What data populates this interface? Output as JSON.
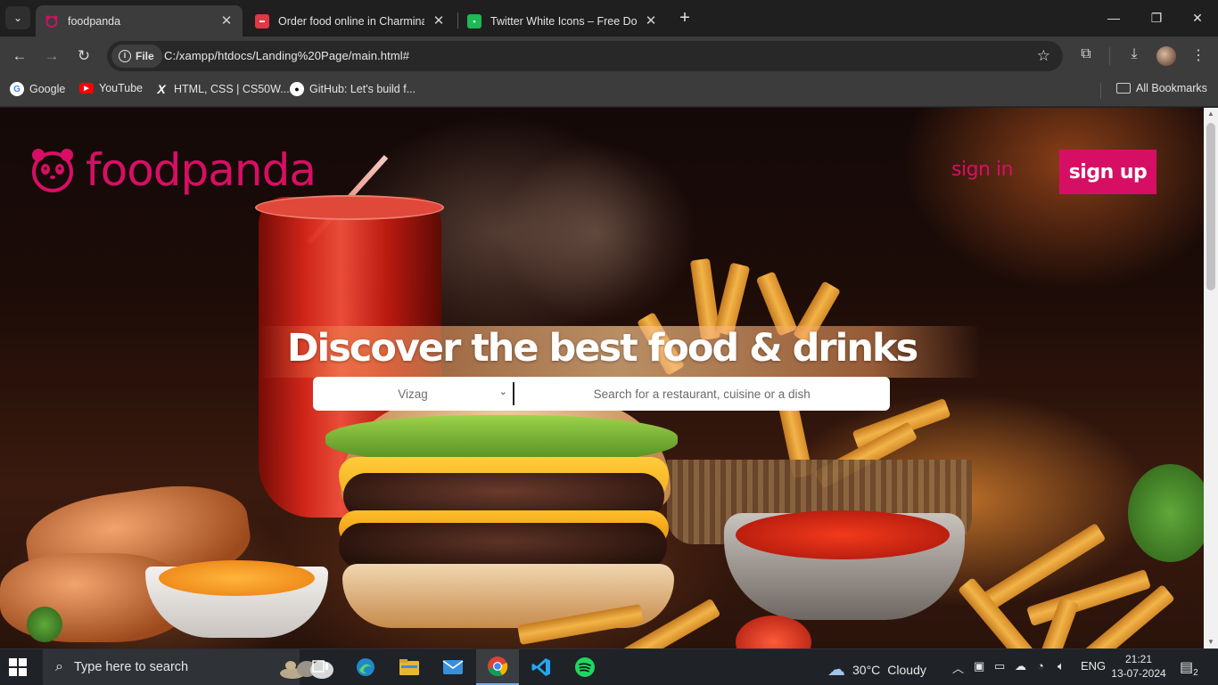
{
  "browser": {
    "tabs": [
      {
        "title": "foodpanda",
        "active": true
      },
      {
        "title": "Order food online in Charminar",
        "active": false
      },
      {
        "title": "Twitter White Icons – Free Down",
        "active": false
      }
    ],
    "site_chip": "File",
    "url": "C:/xampp/htdocs/Landing%20Page/main.html#",
    "bookmarks": [
      {
        "label": "Google",
        "icon": "google-icon"
      },
      {
        "label": "YouTube",
        "icon": "youtube-icon"
      },
      {
        "label": "HTML, CSS | CS50W...",
        "icon": "x-icon"
      },
      {
        "label": "GitHub: Let's build f...",
        "icon": "github-icon"
      }
    ],
    "all_bookmarks": "All Bookmarks"
  },
  "page": {
    "brand": "foodpanda",
    "sign_in": "sign in",
    "sign_up": "sign up",
    "hero_title": "Discover the best food & drinks",
    "city_selected": "Vizag",
    "search_placeholder": "Search for a restaurant, cuisine or a dish",
    "accent_color": "#d70f64"
  },
  "taskbar": {
    "search_placeholder": "Type here to search",
    "weather_temp": "30°C",
    "weather_desc": "Cloudy",
    "language": "ENG",
    "time": "21:21",
    "date": "13-07-2024",
    "notification_count": "2"
  }
}
